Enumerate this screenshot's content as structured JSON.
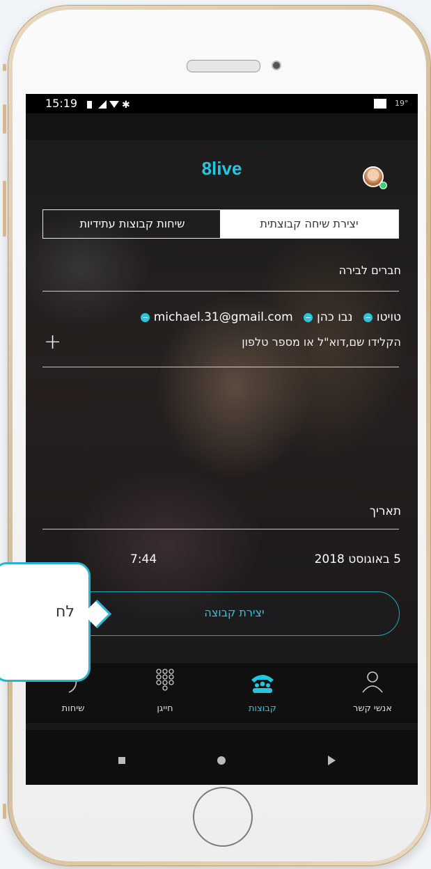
{
  "status_bar": {
    "time": "15:19",
    "temp": "19°"
  },
  "app": {
    "logo": "8live"
  },
  "tabs": [
    {
      "label": "יצירת שיחה קבוצתית",
      "active": true
    },
    {
      "label": "שיחות קבוצות עתידיות",
      "active": false
    }
  ],
  "form": {
    "friends_label": "חברים לבירה",
    "chips": [
      "טויטו",
      "נבו כהן",
      "michael.31@gmail.com"
    ],
    "input_placeholder": "הקלידו שם,דוא\"ל או מספר טלפון",
    "date_label": "תאריך",
    "date_value": "5 באוגוסט 2018",
    "time_value": "7:44",
    "create_button": "יצירת קבוצה"
  },
  "bottom_nav": [
    {
      "label": "אנשי קשר",
      "icon": "person-icon",
      "active": false
    },
    {
      "label": "קבוצות",
      "icon": "group-call-icon",
      "active": true
    },
    {
      "label": "חייגן",
      "icon": "dialpad-icon",
      "active": false
    },
    {
      "label": "שיחות",
      "icon": "recent-calls-icon",
      "active": false
    }
  ],
  "callout": {
    "text": "לח"
  },
  "colors": {
    "accent": "#26c6e0",
    "callout_border": "#27b6d2"
  }
}
